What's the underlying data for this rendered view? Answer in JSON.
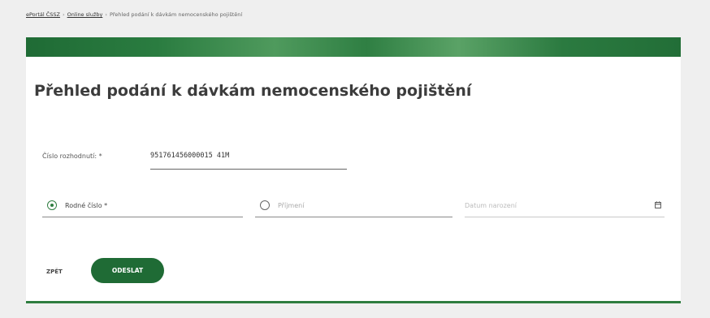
{
  "breadcrumb": {
    "items": [
      "ePortál ČSSZ",
      "Online služby",
      "Přehled podání k dávkám nemocenského pojištění"
    ],
    "separator": "›"
  },
  "page": {
    "title": "Přehled podání k dávkám nemocenského pojištění"
  },
  "form": {
    "decision_number": {
      "label": "Číslo rozhodnutí: *",
      "value": "951761456000015 41M"
    },
    "radio_birth_number": {
      "label": "Rodné číslo *",
      "selected": true
    },
    "radio_surname": {
      "label": "Příjmení",
      "selected": false
    },
    "date_of_birth": {
      "placeholder": "Datum narození",
      "icon": "calendar-icon"
    }
  },
  "actions": {
    "back_label": "ZPĚT",
    "submit_label": "ODESLAT"
  },
  "colors": {
    "brand_green": "#1f6b35",
    "background": "#efefef"
  }
}
